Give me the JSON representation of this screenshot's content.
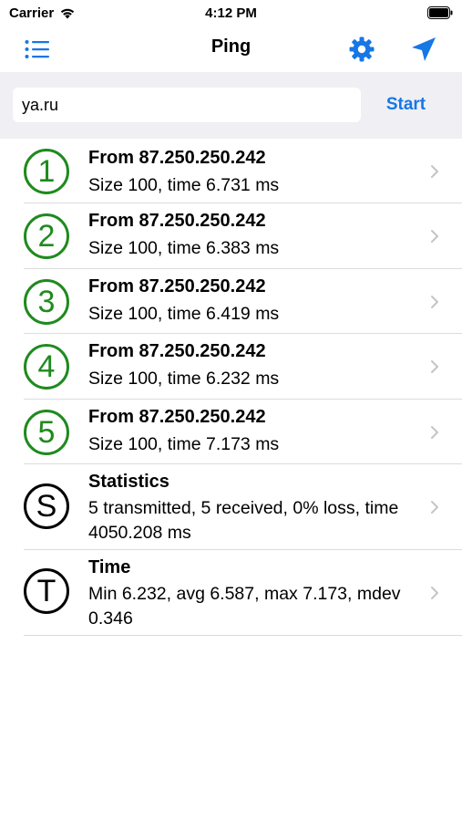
{
  "status_bar": {
    "carrier": "Carrier",
    "time": "4:12 PM",
    "icons": [
      "wifi-icon",
      "battery-icon"
    ]
  },
  "nav": {
    "title": "Ping",
    "left_icon": "list-icon",
    "right_icons": [
      "gear-icon",
      "send-icon"
    ]
  },
  "search": {
    "value": "ya.ru",
    "start_label": "Start"
  },
  "results": [
    {
      "badge": "1",
      "title": "From 87.250.250.242",
      "detail": "Size 100, time 6.731 ms"
    },
    {
      "badge": "2",
      "title": "From 87.250.250.242",
      "detail": "Size 100, time 6.383 ms"
    },
    {
      "badge": "3",
      "title": "From 87.250.250.242",
      "detail": "Size 100, time 6.419 ms"
    },
    {
      "badge": "4",
      "title": "From 87.250.250.242",
      "detail": "Size 100, time 6.232 ms"
    },
    {
      "badge": "5",
      "title": "From 87.250.250.242",
      "detail": "Size 100, time 7.173 ms"
    }
  ],
  "statistics": {
    "badge": "S",
    "title": "Statistics",
    "detail": "5 transmitted, 5 received, 0% loss, time 4050.208 ms"
  },
  "time_summary": {
    "badge": "T",
    "title": "Time",
    "detail": "Min 6.232, avg 6.587, max 7.173, mdev 0.346"
  },
  "colors": {
    "accent": "#1677e5",
    "result_badge": "#1f8a1f",
    "summary_badge": "#000000",
    "search_background": "#efeff4",
    "separator": "#dcdce0"
  }
}
